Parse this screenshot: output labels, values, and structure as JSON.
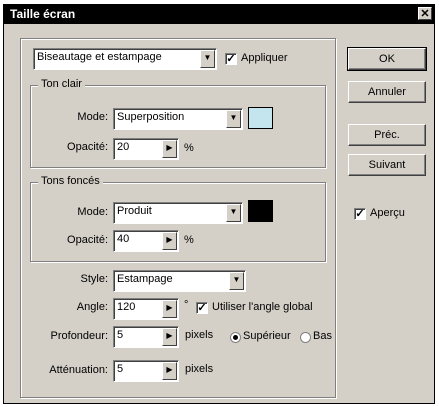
{
  "window": {
    "title": "Taille écran",
    "close_glyph": "✕"
  },
  "style_select": {
    "value": "Biseautage et estampage",
    "arrow": "▼"
  },
  "apply": {
    "label": "Appliquer",
    "checked": true,
    "mark": "✓"
  },
  "buttons": {
    "ok": "OK",
    "cancel": "Annuler",
    "prev": "Préc.",
    "next": "Suivant"
  },
  "preview": {
    "label": "Aperçu",
    "checked": true,
    "mark": "✓"
  },
  "highlight": {
    "legend": "Ton clair",
    "mode_label": "Mode:",
    "mode_value": "Superposition",
    "opacity_label": "Opacité:",
    "opacity_value": "20",
    "unit": "%",
    "color": "#c4e4ee"
  },
  "shadow": {
    "legend": "Tons foncés",
    "mode_label": "Mode:",
    "mode_value": "Produit",
    "opacity_label": "Opacité:",
    "opacity_value": "40",
    "unit": "%",
    "color": "#000000"
  },
  "bevel": {
    "style_label": "Style:",
    "style_value": "Estampage",
    "angle_label": "Angle:",
    "angle_value": "120",
    "angle_unit": "°",
    "global_angle_label": "Utiliser l'angle global",
    "global_angle_checked": true,
    "depth_label": "Profondeur:",
    "depth_value": "5",
    "depth_unit": "pixels",
    "up_label": "Supérieur",
    "down_label": "Bas",
    "direction": "up",
    "soften_label": "Atténuation:",
    "soften_value": "5",
    "soften_unit": "pixels"
  },
  "icons": {
    "spin_arrow": "▶",
    "dropdown_arrow": "▼"
  }
}
